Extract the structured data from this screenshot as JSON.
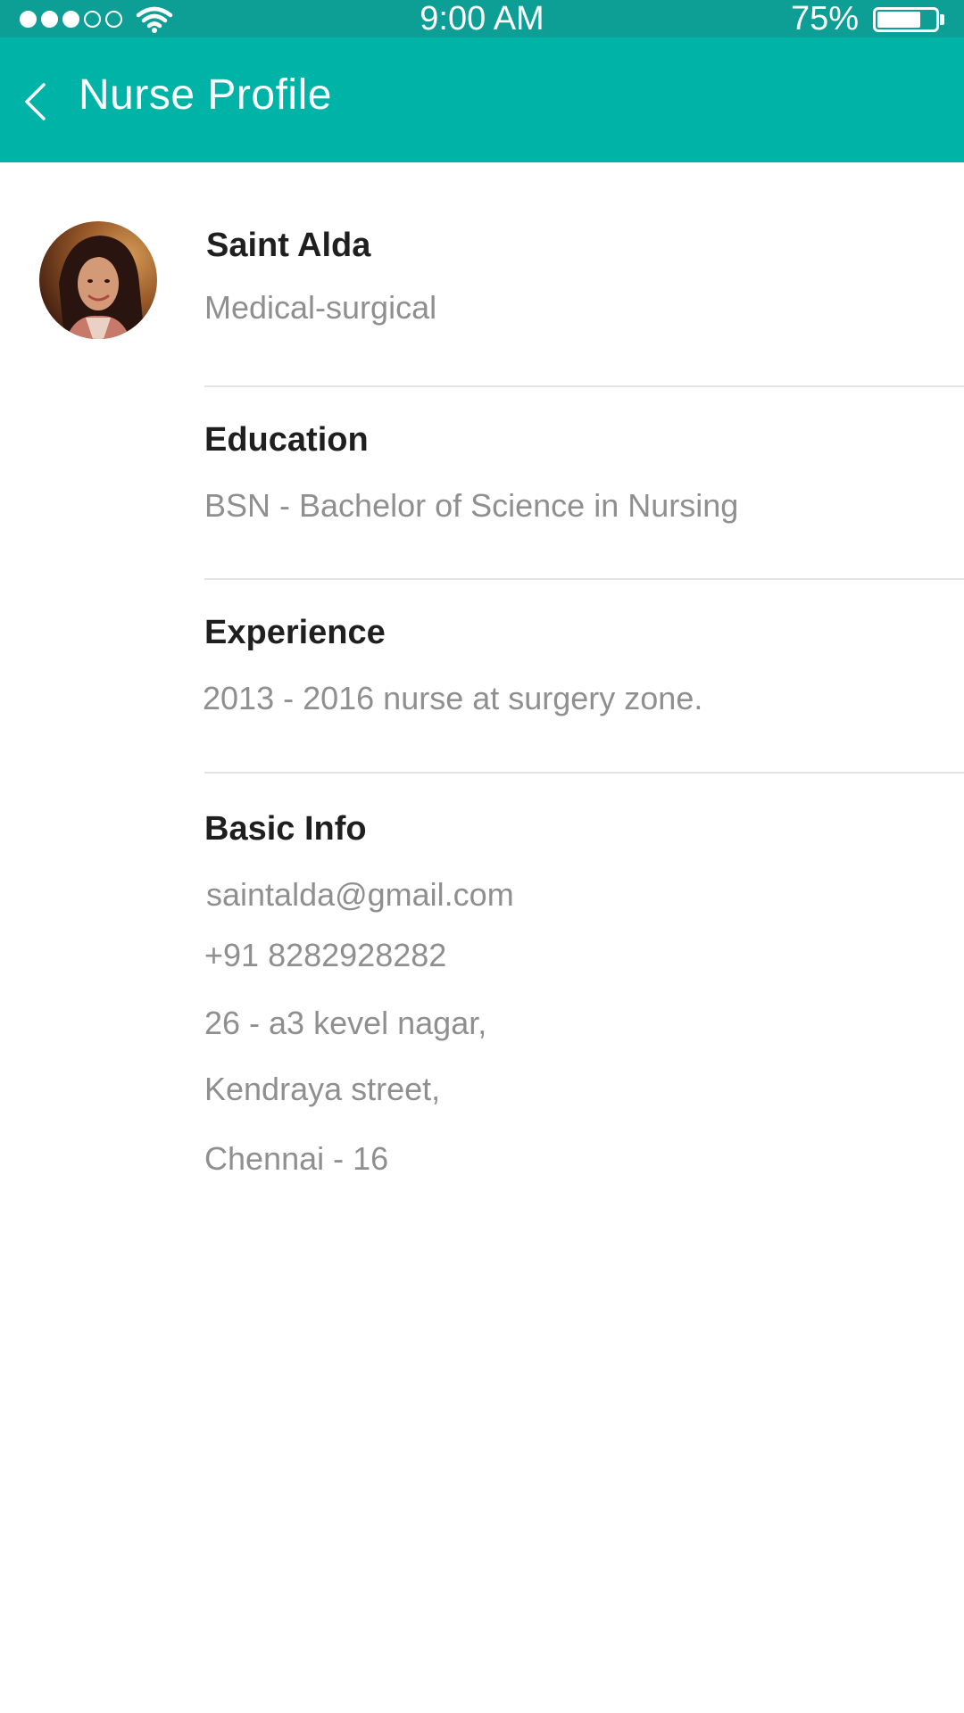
{
  "status_bar": {
    "signal_filled": 3,
    "signal_total": 5,
    "time": "9:00 AM",
    "battery_percent": "75%",
    "battery_level": 0.75
  },
  "header": {
    "title": "Nurse Profile",
    "back_icon": "chevron-left-icon",
    "background_color": "#00b3a7"
  },
  "profile": {
    "name": "Saint Alda",
    "specialty": "Medical-surgical"
  },
  "education": {
    "title": "Education",
    "value": "BSN -  Bachelor of Science in Nursing"
  },
  "experience": {
    "title": "Experience",
    "value": "2013 - 2016 nurse at surgery zone."
  },
  "basic_info": {
    "title": "Basic Info",
    "email": "saintalda@gmail.com",
    "phone": "+91 8282928282",
    "address_line1": "26 - a3 kevel nagar,",
    "address_line2": "Kendraya street,",
    "address_line3": "Chennai - 16"
  }
}
